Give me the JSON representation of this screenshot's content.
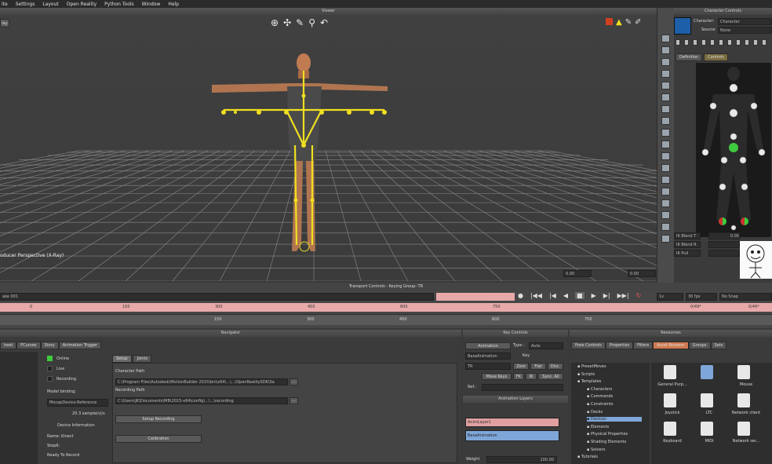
{
  "menu": [
    "ite",
    "Settings",
    "Layout",
    "Open Reality",
    "Python Tools",
    "Window",
    "Help"
  ],
  "viewer": {
    "title": "Viewer",
    "left_tag": "lay",
    "viewport_label": "oducer Perspective (X-Ray)",
    "bottom_values": [
      "0.00",
      "0.00"
    ]
  },
  "character_controls": {
    "title": "Character Controls",
    "character_label": "Character:",
    "character_value": "Character",
    "source_label": "Source:",
    "source_value": "None",
    "tabs": [
      "Definition",
      "Controls"
    ],
    "sliders": [
      {
        "label": "IK Blend T",
        "value": "0.00"
      },
      {
        "label": "IK Blend R",
        "value": ""
      },
      {
        "label": "IK Pull",
        "value": ""
      }
    ]
  },
  "transport": {
    "title": "Transport Controls  -  Keying Group: TR",
    "take": "ake 001",
    "fps": "30 fps",
    "speed": "1x",
    "snap": "No Snap",
    "frame_right": "0/49*",
    "frame_center": ""
  },
  "timeline": {
    "ticks": [
      "0",
      "150",
      "300",
      "450",
      "600",
      "750"
    ],
    "end_label": "0/49*",
    "mid_label": "0/49*"
  },
  "navigator": {
    "title": "Navigator",
    "tabs": [
      "heet",
      "FCurves",
      "Story",
      "Animation Trigger"
    ],
    "online": "Online",
    "live": "Live",
    "recording": "Recording",
    "model_binding": "Model binding:",
    "binding_value": "MocapDevice:Reference",
    "rate": "20.3 sample(s)/s",
    "device_info": "Device Information",
    "name": "Name: Kinect",
    "step": "Step6:",
    "ready": "Ready To Record",
    "sub_tabs": [
      "Setup",
      "Joints"
    ],
    "character_path_label": "Character Path",
    "character_path": "C:\\Program Files\\Autodesk\\MotionBuilder 2015\\bin\\x64\\...\\...\\OpenRealitySDK\\Sa",
    "recording_path_label": "Recording Path",
    "recording_path": "C:\\Users\\JK\\Documents\\MB\\2015-x64\\config\\...\\...\\recording",
    "setup_recording": "Setup Recording",
    "calibration": "Calibration"
  },
  "key_controls": {
    "title": "Key Controls",
    "animation": "Animation",
    "type_label": "Type :",
    "type_value": "Auto",
    "layer_value": "BaseAnimation",
    "key_label": "Key",
    "tr_value": "TR",
    "zero": "Zero",
    "flat": "Flat",
    "disc": "Disc.",
    "move_keys": "Move Keys",
    "fk": "FK",
    "ik": "IK",
    "sync": "Sync. All",
    "ref_label": "Ref.:",
    "layers_title": "Animation Layers",
    "layers": [
      "AnimLayer1",
      "BaseAnimation"
    ],
    "weight_label": "Weight",
    "weight_value": "100.00"
  },
  "resources": {
    "title": "Resources",
    "tabs": [
      "Pose Controls",
      "Properties",
      "Filters",
      "Asset Browser",
      "Groups",
      "Sets"
    ],
    "tree": [
      "PresetMoves",
      "Scripts",
      "Templates",
      "Characters",
      "Commands",
      "Constraints",
      "Decks",
      "Devices",
      "Elements",
      "Physical Properties",
      "Shading Elements",
      "Solvers",
      "Tutorials"
    ],
    "assets": [
      "General Purp...",
      "",
      "Mouse",
      "Joystick",
      "LTC",
      "Network client",
      "Keyboard",
      "MIDI",
      "Network ser...",
      "Spac"
    ]
  },
  "colors": {
    "accent_yellow": "#f0e020",
    "selection_blue": "#7fa6d8",
    "online_green": "#3ecb3e",
    "timeline_red": "#e8a9a9"
  }
}
